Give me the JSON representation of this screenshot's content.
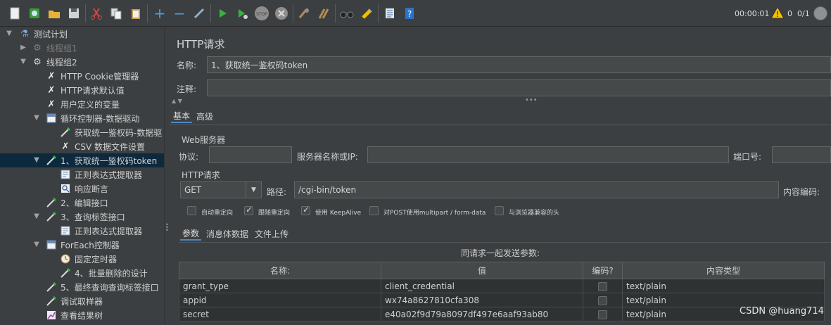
{
  "toolbar": {
    "icons": [
      "new-icon",
      "templates-icon",
      "open-icon",
      "save-icon",
      "cut-icon",
      "copy-icon",
      "paste-icon",
      "expand-icon",
      "collapse-icon",
      "toggle-icon",
      "start-icon",
      "start-no-pause-icon",
      "stop-icon",
      "shutdown-icon",
      "clear-icon",
      "clear-all-icon",
      "search-icon",
      "reset-search-icon",
      "function-helper-icon",
      "help-icon"
    ],
    "elapsed_time": "00:00:01",
    "warning_count": "0",
    "thread_count": "0/1"
  },
  "tree": {
    "items": [
      {
        "label": "测试计划",
        "icon": "test-plan-icon"
      },
      {
        "label": "线程组1",
        "icon": "gear-icon"
      },
      {
        "label": "线程组2",
        "icon": "gear-icon"
      },
      {
        "label": "HTTP Cookie管理器",
        "icon": "wrench-icon"
      },
      {
        "label": "HTTP请求默认值",
        "icon": "wrench-icon"
      },
      {
        "label": "用户定义的变量",
        "icon": "wrench-icon"
      },
      {
        "label": "循环控制器-数据驱动",
        "icon": "controller-icon"
      },
      {
        "label": "获取统一鉴权码-数据驱",
        "icon": "pipette-icon"
      },
      {
        "label": "CSV 数据文件设置",
        "icon": "wrench-icon"
      },
      {
        "label": "1、获取统一鉴权码token",
        "icon": "pipette-icon"
      },
      {
        "label": "正则表达式提取器",
        "icon": "extractor-icon"
      },
      {
        "label": "响应断言",
        "icon": "assertion-icon"
      },
      {
        "label": "2、编辑接口",
        "icon": "pipette-icon"
      },
      {
        "label": "3、查询标签接口",
        "icon": "pipette-icon"
      },
      {
        "label": "正则表达式提取器",
        "icon": "extractor-icon"
      },
      {
        "label": "ForEach控制器",
        "icon": "controller-icon"
      },
      {
        "label": "固定定时器",
        "icon": "timer-icon"
      },
      {
        "label": "4、批量删除的设计",
        "icon": "pipette-icon"
      },
      {
        "label": "5、最终查询查询标签接口",
        "icon": "pipette-icon"
      },
      {
        "label": "调试取样器",
        "icon": "pipette-icon"
      },
      {
        "label": "查看结果树",
        "icon": "chart-icon"
      }
    ]
  },
  "panel": {
    "title": "HTTP请求",
    "name_label": "名称:",
    "name_value": "1、获取统一鉴权码token",
    "comment_label": "注释:",
    "comment_value": "",
    "tabs": [
      "基本",
      "高级"
    ],
    "web_server_title": "Web服务器",
    "protocol_label": "协议:",
    "protocol_value": "",
    "server_label": "服务器名称或IP:",
    "server_value": "",
    "port_label": "端口号:",
    "port_value": "",
    "http_request_title": "HTTP请求",
    "method": "GET",
    "path_label": "路径:",
    "path_value": "/cgi-bin/token",
    "encoding_label": "内容编码:",
    "checkboxes": [
      {
        "label": "自动重定向",
        "checked": false
      },
      {
        "label": "跟随重定向",
        "checked": true
      },
      {
        "label": "使用 KeepAlive",
        "checked": true
      },
      {
        "label": "对POST使用multipart / form-data",
        "checked": false
      },
      {
        "label": "与浏览器兼容的头",
        "checked": false
      }
    ],
    "sub_tabs": [
      "参数",
      "消息体数据",
      "文件上传"
    ],
    "params_title": "同请求一起发送参数:",
    "columns": [
      "名称:",
      "值",
      "编码?",
      "内容类型"
    ],
    "rows": [
      {
        "name": "grant_type",
        "value": "client_credential",
        "content_type": "text/plain"
      },
      {
        "name": "appid",
        "value": "wx74a8627810cfa308",
        "content_type": "text/plain"
      },
      {
        "name": "secret",
        "value": "e40a02f9d79a8097df497e6aaf93ab80",
        "content_type": "text/plain"
      }
    ]
  },
  "watermark": "CSDN @huang714"
}
